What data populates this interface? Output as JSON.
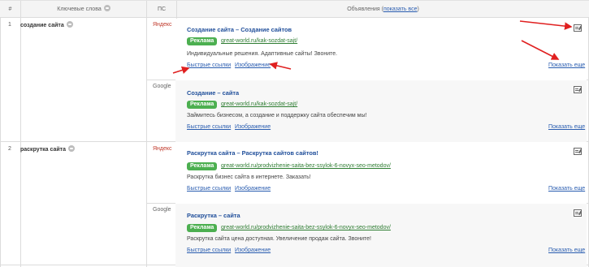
{
  "header": {
    "num": "#",
    "keywords": "Ключевые слова",
    "ps": "ПС",
    "ads": "Объявления",
    "show_all": "показать все"
  },
  "rows": [
    {
      "num": "1",
      "keyword": "создание сайта",
      "ads": [
        {
          "engine": "Яндекс",
          "title": "Создание сайта – Создание сайтов",
          "badge": "Реклама",
          "url": "great-world.ru/kak-sozdat-sajt/",
          "text": "Индивидуальные решения. Адаптивные сайты! Звоните.",
          "quick_links": "Быстрые ссылки",
          "image": "Изображение",
          "show_more": "Показать еще"
        },
        {
          "engine": "Google",
          "title": "Создание – сайта",
          "badge": "Реклама",
          "url": "great-world.ru/kak-sozdat-sajt/",
          "text": "Займитесь бизнесом, а создание и поддержку сайта обеспечим мы!",
          "quick_links": "Быстрые ссылки",
          "image": "Изображение",
          "show_more": "Показать еще"
        }
      ]
    },
    {
      "num": "2",
      "keyword": "раскрутка сайта",
      "ads": [
        {
          "engine": "Яндекс",
          "title": "Раскрутка сайта – Раскрутка сайтов сайтов!",
          "badge": "Реклама",
          "url": "great-world.ru/prodvizhenie-saita-bez-ssylok-6-novyx-seo-metodov/",
          "text": "Раскрутка бизнес сайта в интернете. Заказать!",
          "quick_links": "Быстрые ссылки",
          "image": "Изображение",
          "show_more": "Показать еще"
        },
        {
          "engine": "Google",
          "title": "Раскрутка – сайта",
          "badge": "Реклама",
          "url": "great-world.ru/prodvizhenie-saita-bez-ssylok-6-novyx-seo-metodov/",
          "text": "Раскрутка сайта цена доступная. Увеличение продаж сайта. Звоните!",
          "quick_links": "Быстрые ссылки",
          "image": "Изображение",
          "show_more": "Показать еще"
        }
      ]
    }
  ],
  "colors": {
    "accent_link": "#2a5db0",
    "ad_title": "#1f4e9a",
    "badge_green": "#4caf50",
    "url_green": "#2e7d32",
    "yandex_red": "#c0392b",
    "annotation_arrow": "#e02020"
  }
}
